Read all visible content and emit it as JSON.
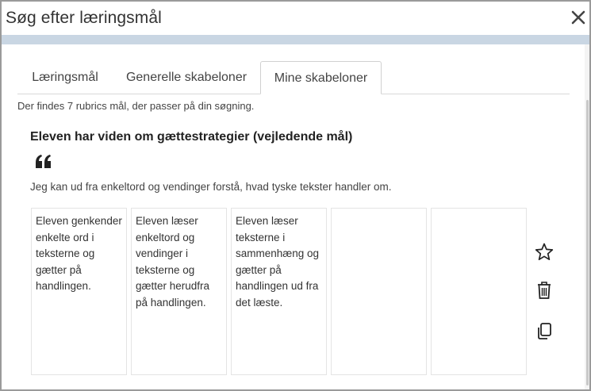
{
  "dialog": {
    "title": "Søg efter læringsmål"
  },
  "tabs": [
    {
      "label": "Læringsmål",
      "active": false
    },
    {
      "label": "Generelle skabeloner",
      "active": false
    },
    {
      "label": "Mine skabeloner",
      "active": true
    }
  ],
  "result_count": "Der findes 7 rubrics mål, der passer på din søgning.",
  "goal": {
    "title": "Eleven har viden om gættestrategier (vejledende mål)",
    "description": "Jeg kan ud fra enkeltord og vendinger forstå, hvad tyske tekster handler om.",
    "levels": [
      "Eleven genkender enkelte ord i teksterne og gætter på handlingen.",
      "Eleven læser enkeltord og vendinger i teksterne og gætter herudfra på handlingen.",
      "Eleven læser teksterne i sammenhæng og gætter på handlingen ud fra det læste.",
      "",
      ""
    ]
  },
  "icons": {
    "close": "close-icon",
    "quote": "quote-icon",
    "favorite": "star-icon",
    "delete": "trash-icon",
    "copy": "copy-icon"
  },
  "colors": {
    "title_rule": "#c9d6e3",
    "border": "#9a9a9a"
  }
}
